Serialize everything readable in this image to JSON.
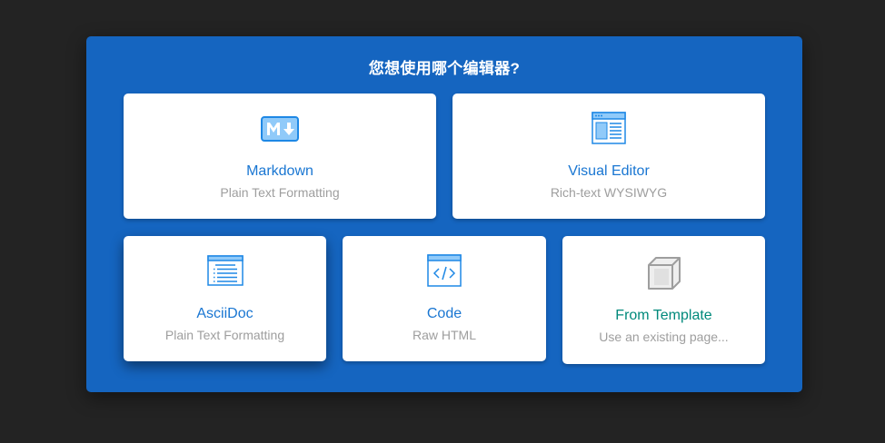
{
  "dialog": {
    "title": "您想使用哪个编辑器?"
  },
  "editors": [
    {
      "title": "Markdown",
      "subtitle": "Plain Text Formatting",
      "icon": "markdown-icon"
    },
    {
      "title": "Visual Editor",
      "subtitle": "Rich-text WYSIWYG",
      "icon": "visual-editor-icon"
    },
    {
      "title": "AsciiDoc",
      "subtitle": "Plain Text Formatting",
      "icon": "asciidoc-icon"
    },
    {
      "title": "Code",
      "subtitle": "Raw HTML",
      "icon": "code-icon"
    },
    {
      "title": "From Template",
      "subtitle": "Use an existing page...",
      "icon": "template-cube-icon"
    }
  ],
  "colors": {
    "backdrop": "#232323",
    "dialog": "#1565c0",
    "accent": "#1976d2",
    "icon_fill": "#90caf9",
    "icon_stroke": "#1e88e5",
    "template_accent": "#00897b",
    "muted": "#9e9e9e"
  }
}
